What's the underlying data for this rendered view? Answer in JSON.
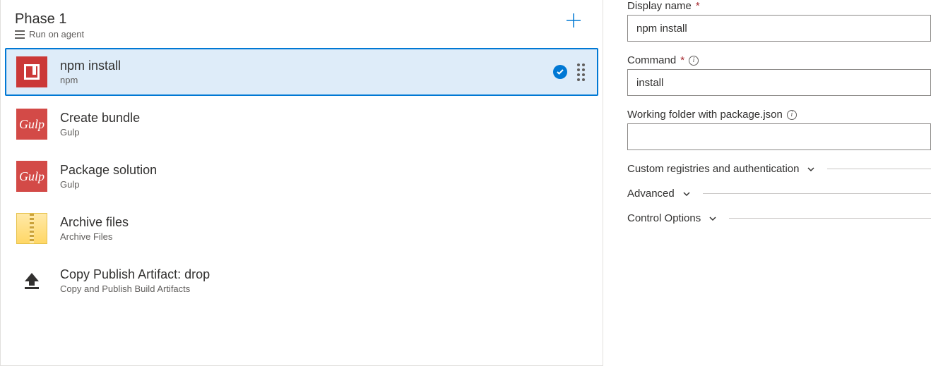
{
  "phase": {
    "title": "Phase 1",
    "subtitle": "Run on agent"
  },
  "tasks": [
    {
      "title": "npm install",
      "subtitle": "npm",
      "icon": "npm",
      "selected": true
    },
    {
      "title": "Create bundle",
      "subtitle": "Gulp",
      "icon": "gulp",
      "selected": false
    },
    {
      "title": "Package solution",
      "subtitle": "Gulp",
      "icon": "gulp",
      "selected": false
    },
    {
      "title": "Archive files",
      "subtitle": "Archive Files",
      "icon": "archive",
      "selected": false
    },
    {
      "title": "Copy Publish Artifact: drop",
      "subtitle": "Copy and Publish Build Artifacts",
      "icon": "upload",
      "selected": false
    }
  ],
  "form": {
    "displayName": {
      "label": "Display name",
      "required": true,
      "value": "npm install"
    },
    "command": {
      "label": "Command",
      "required": true,
      "info": true,
      "value": "install"
    },
    "workingFolder": {
      "label": "Working folder with package.json",
      "info": true,
      "value": ""
    }
  },
  "sections": [
    {
      "label": "Custom registries and authentication"
    },
    {
      "label": "Advanced"
    },
    {
      "label": "Control Options"
    }
  ]
}
